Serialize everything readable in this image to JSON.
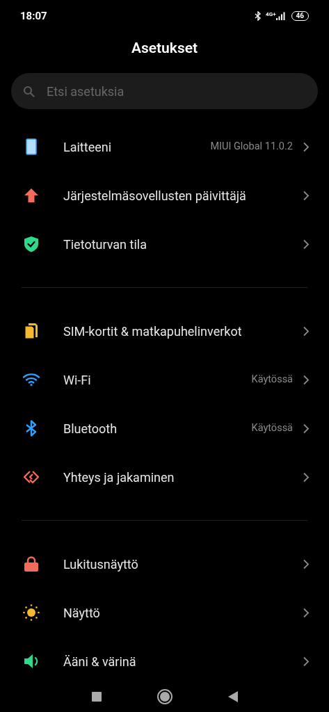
{
  "status_bar": {
    "time": "18:07",
    "network": "4G+",
    "battery": "46"
  },
  "title": "Asetukset",
  "search": {
    "placeholder": "Etsi asetuksia"
  },
  "sections": [
    {
      "items": [
        {
          "kind": "device",
          "label": "Laitteeni",
          "value": "MIUI Global 11.0.2"
        },
        {
          "kind": "update",
          "label": "Järjestelmäsovellusten päivittäjä"
        },
        {
          "kind": "security",
          "label": "Tietoturvan tila"
        }
      ]
    },
    {
      "items": [
        {
          "kind": "sim",
          "label": "SIM-kortit & matkapuhelinverkot"
        },
        {
          "kind": "wifi",
          "label": "Wi-Fi",
          "value": "Käytössä"
        },
        {
          "kind": "bluetooth",
          "label": "Bluetooth",
          "value": "Käytössä"
        },
        {
          "kind": "share",
          "label": "Yhteys ja jakaminen"
        }
      ]
    },
    {
      "items": [
        {
          "kind": "lock",
          "label": "Lukitusnäyttö"
        },
        {
          "kind": "display",
          "label": "Näyttö"
        },
        {
          "kind": "sound",
          "label": "Ääni & värinä"
        }
      ]
    }
  ]
}
